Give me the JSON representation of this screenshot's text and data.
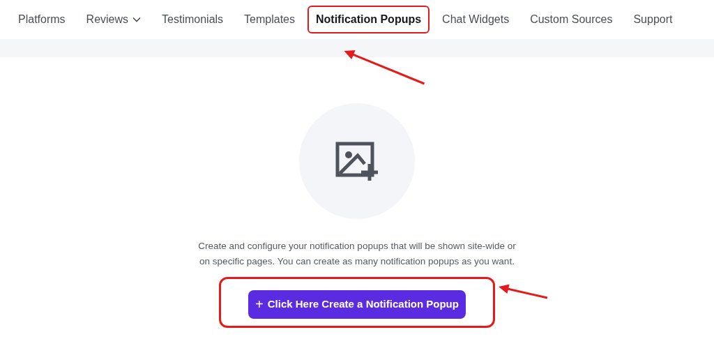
{
  "nav": {
    "items": [
      {
        "label": "Platforms",
        "selected": false,
        "dropdown": false,
        "highlighted": false
      },
      {
        "label": "Reviews",
        "selected": false,
        "dropdown": true,
        "highlighted": false
      },
      {
        "label": "Testimonials",
        "selected": false,
        "dropdown": false,
        "highlighted": false
      },
      {
        "label": "Templates",
        "selected": false,
        "dropdown": false,
        "highlighted": false
      },
      {
        "label": "Notification Popups",
        "selected": true,
        "dropdown": false,
        "highlighted": true
      },
      {
        "label": "Chat Widgets",
        "selected": false,
        "dropdown": false,
        "highlighted": false
      },
      {
        "label": "Custom Sources",
        "selected": false,
        "dropdown": false,
        "highlighted": false
      },
      {
        "label": "Support",
        "selected": false,
        "dropdown": false,
        "highlighted": false
      }
    ]
  },
  "empty_state": {
    "description": "Create and configure your notification popups that will be shown site-wide or on specific pages. You can create as many notification popups as you want.",
    "button": {
      "icon": "+",
      "label": "Click Here Create a Notification Popup",
      "highlighted": true
    }
  }
}
